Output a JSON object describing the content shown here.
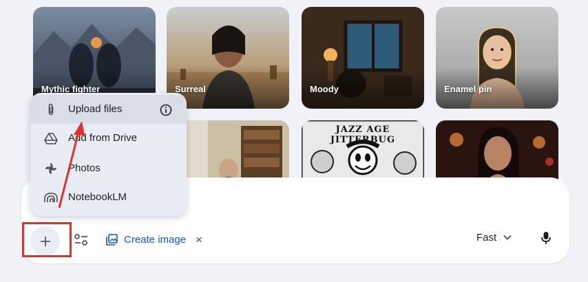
{
  "style_cards": [
    {
      "label": "Mythic fighter"
    },
    {
      "label": "Surreal"
    },
    {
      "label": "Moody"
    },
    {
      "label": "Enamel pin"
    },
    {
      "label": ""
    },
    {
      "label": ""
    },
    {
      "label": "JAZZ AGE JITTERBUG"
    },
    {
      "label": ""
    }
  ],
  "upload_menu": {
    "items": [
      {
        "label": "Upload files",
        "icon": "paperclip-icon",
        "selected": true
      },
      {
        "label": "Add from Drive",
        "icon": "drive-icon"
      },
      {
        "label": "Photos",
        "icon": "photos-icon"
      },
      {
        "label": "NotebookLM",
        "icon": "notebooklm-icon"
      }
    ],
    "info_icon": "info-icon"
  },
  "composer": {
    "create_image_label": "Create image",
    "remove_symbol": "×",
    "model_label": "Fast"
  },
  "colors": {
    "accent": "#0b57d0",
    "highlight": "#e0312b",
    "page_bg": "#f0f2f7",
    "menu_bg": "#e7ecf5"
  }
}
